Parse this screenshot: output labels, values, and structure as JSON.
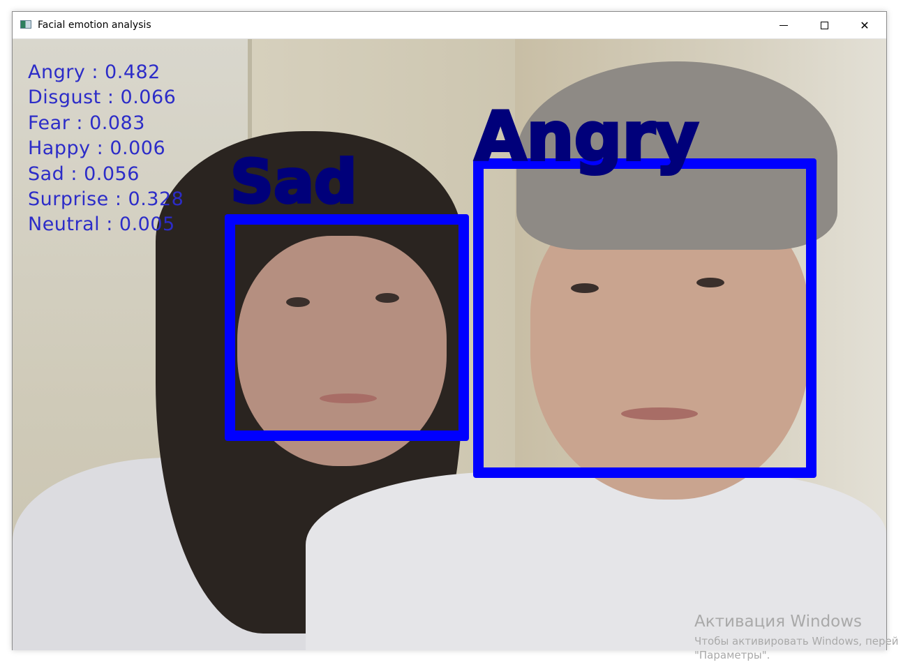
{
  "window": {
    "title": "Facial emotion analysis",
    "controls": {
      "minimize": "",
      "maximize": "",
      "close": "✕"
    }
  },
  "emotion_stats": [
    {
      "label": "Angry : 0.482"
    },
    {
      "label": "Disgust : 0.066"
    },
    {
      "label": "Fear : 0.083"
    },
    {
      "label": "Happy : 0.006"
    },
    {
      "label": "Sad : 0.056"
    },
    {
      "label": "Surprise : 0.328"
    },
    {
      "label": "Neutral : 0.005"
    }
  ],
  "faces": [
    {
      "emotion": "Sad",
      "box_color": "#0000ff"
    },
    {
      "emotion": "Angry",
      "box_color": "#0000ff"
    }
  ],
  "watermark": {
    "title": "Активация Windows",
    "line1": "Чтобы активировать Windows, перей",
    "line2": "\"Параметры\"."
  }
}
